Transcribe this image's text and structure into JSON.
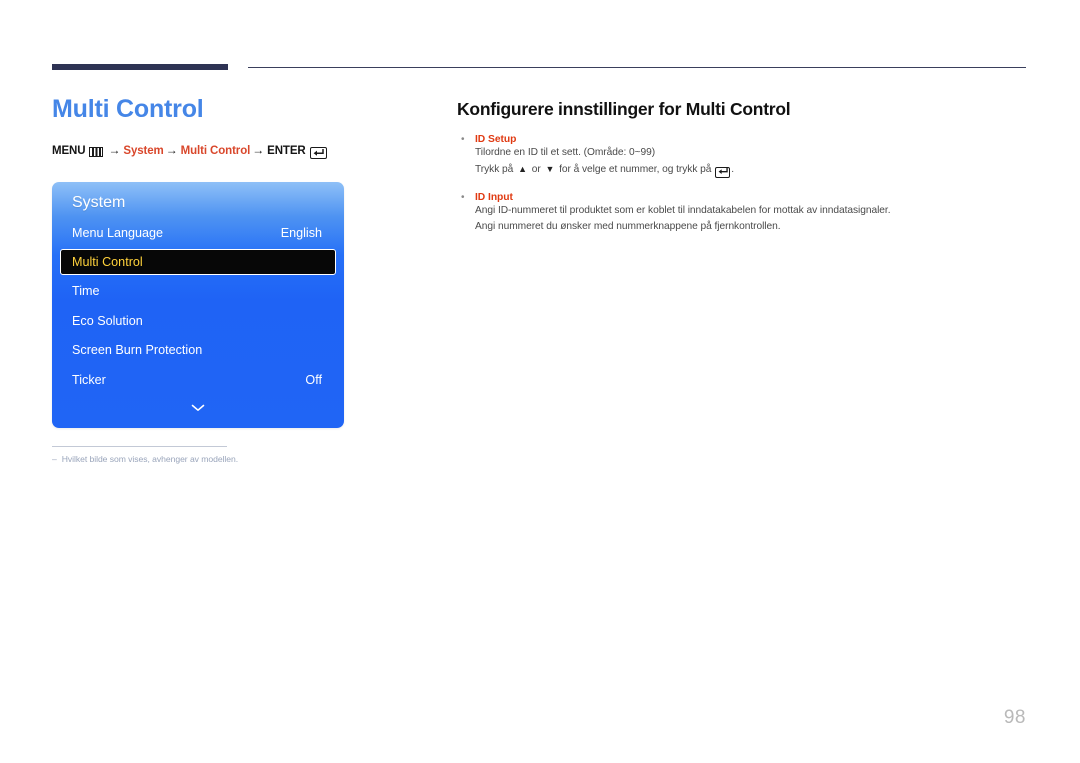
{
  "document": {
    "page_number": "98"
  },
  "left": {
    "title": "Multi Control",
    "breadcrumb": {
      "menu_label": "MENU",
      "menu_icon": "menu-grid-icon",
      "arrow": "→",
      "step1": "System",
      "step2": "Multi Control",
      "enter_label": "ENTER",
      "enter_icon": "enter-key-icon"
    },
    "footnote": {
      "dash": "–",
      "text": "Hvilket bilde som vises, avhenger av modellen."
    }
  },
  "osd": {
    "header": "System",
    "rows": [
      {
        "label": "Menu Language",
        "value": "English",
        "selected": false
      },
      {
        "label": "Multi Control",
        "value": "",
        "selected": true
      },
      {
        "label": "Time",
        "value": "",
        "selected": false
      },
      {
        "label": "Eco Solution",
        "value": "",
        "selected": false
      },
      {
        "label": "Screen Burn Protection",
        "value": "",
        "selected": false
      },
      {
        "label": "Ticker",
        "value": "Off",
        "selected": false
      }
    ],
    "scroll_icon": "chevron-down-icon",
    "colors": {
      "panel_blue": "#1f63f5",
      "selected_bg": "#070707",
      "selected_text": "#ffd23b"
    }
  },
  "right": {
    "section_title": "Konfigurere innstillinger for Multi Control",
    "bullets": [
      {
        "marker": "•",
        "label": "ID Setup",
        "lines": [
          {
            "parts": [
              {
                "t": "text",
                "v": "Tilordne en ID til et sett. (Område: 0~99)"
              }
            ]
          },
          {
            "parts": [
              {
                "t": "text",
                "v": "Trykk på "
              },
              {
                "t": "glyph",
                "v": "▲"
              },
              {
                "t": "text",
                "v": " or "
              },
              {
                "t": "glyph",
                "v": "▼"
              },
              {
                "t": "text",
                "v": " for å velge et nummer, og trykk på "
              },
              {
                "t": "enter",
                "v": "enter-key-icon"
              },
              {
                "t": "text",
                "v": "."
              }
            ]
          }
        ]
      },
      {
        "marker": "•",
        "label": "ID Input",
        "lines": [
          {
            "parts": [
              {
                "t": "text",
                "v": "Angi ID-nummeret til produktet som er koblet til inndatakabelen for mottak av inndatasignaler."
              }
            ]
          },
          {
            "parts": [
              {
                "t": "text",
                "v": "Angi nummeret du ønsker med nummerknappene på fjernkontrollen."
              }
            ]
          }
        ]
      }
    ],
    "colors": {
      "label_red": "#e03a12",
      "title_black": "#111111"
    }
  },
  "theme": {
    "title_blue": "#4586e7",
    "rule_navy": "#2e3354",
    "breadcrumb_orange": "#d9472b",
    "footnote_gray": "#9aa5bb"
  }
}
